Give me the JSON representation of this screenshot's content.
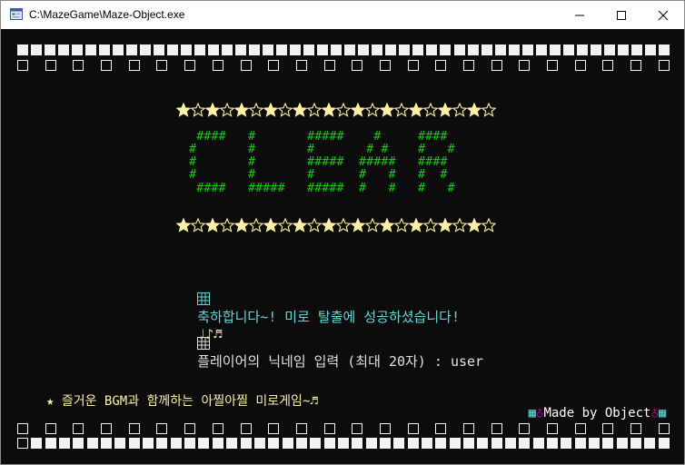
{
  "window": {
    "title": "C:\\MazeGame\\Maze-Object.exe",
    "controls": [
      "minimize",
      "maximize",
      "close"
    ]
  },
  "colors": {
    "console_bg": "#0c0c0c",
    "ascii_art": "#16c60c",
    "star": "#f9f1a5",
    "message": "#61d6d6",
    "music_notes": "#f9f1a5",
    "prompt": "#e0e0e0",
    "tagline": "#f9f1a5",
    "credit": "#ffffff",
    "credit_accent": "#b4009e",
    "credit_grid": "#61d6d6"
  },
  "border_top_row1": "■■■■■■■■■■■■■■■■■■■■■■■■■■■■■■■■■■■■■■■■■■■■■■■■",
  "border_top_row2": "□□□□□□□□□□□□□□□□□□□□□□□□",
  "border_bottom_row1": "□□□□□□□□□□□□□□□□□□□□□□□□",
  "border_bottom_row2": "□■■■■■■■■■■■■■■■■■■■■■■■■■■■■■■■■■■■■■■■■■■■■■■",
  "star_line_top": "★☆★☆★☆★☆★☆★☆★☆★☆★☆★☆★☆",
  "star_line_bottom": "★☆★☆★☆★☆★☆★☆★☆★☆★☆★☆★☆",
  "clear_art": [
    " ####   #       #####    #     ####",
    "#       #       #       # #    #   #",
    "#       #       #####  #####   ####",
    "#       #       #      #   #   #  #",
    " ####   #####   #####  #   #   #   #"
  ],
  "congrats": {
    "icon": "grid-square-icon",
    "text": "축하합니다~! 미로 탈출에 성공하셨습니다!",
    "notes": "♩♪♬"
  },
  "nickname_prompt": {
    "icon": "grid-square-icon",
    "text": "플레이어의 닉네임 입력 (최대 20자) : ",
    "value": "user"
  },
  "footer": {
    "tagline": "★ 즐거운 BGM과 함께하는 아찔아찔 미로게임~♬",
    "credit_grid": "▦",
    "credit_symbol": "♁",
    "credit_text": "Made by Object"
  }
}
